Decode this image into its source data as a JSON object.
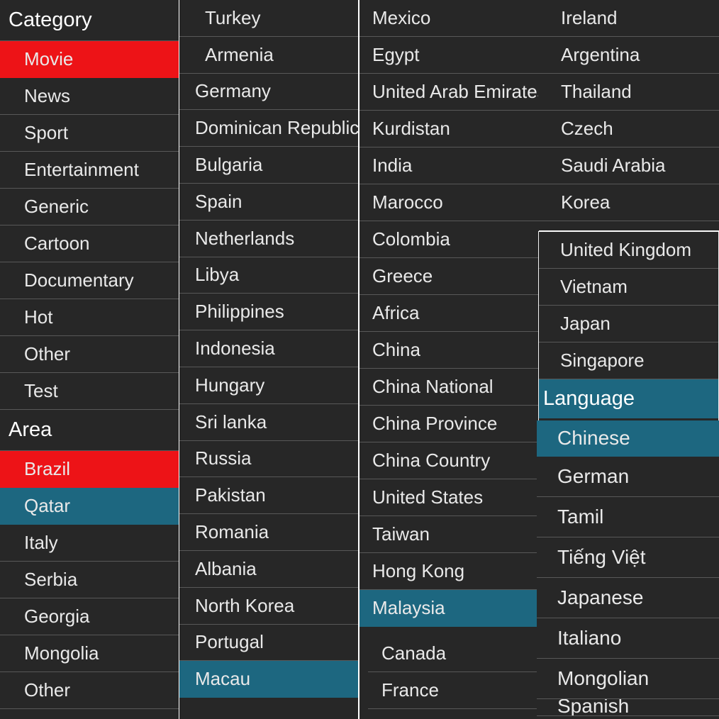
{
  "theme": {
    "background": "#272727",
    "selected_red": "#ed1317",
    "selected_teal": "#1d6780",
    "text": "#e9e9e9",
    "separator": "#585858"
  },
  "column_category_area": {
    "headers": {
      "category": "Category",
      "area": "Area"
    },
    "category_items": [
      {
        "label": "Movie",
        "state": "selected-red"
      },
      {
        "label": "News",
        "state": "normal"
      },
      {
        "label": "Sport",
        "state": "normal"
      },
      {
        "label": "Entertainment",
        "state": "normal"
      },
      {
        "label": "Generic",
        "state": "normal"
      },
      {
        "label": "Cartoon",
        "state": "normal"
      },
      {
        "label": "Documentary",
        "state": "normal"
      },
      {
        "label": "Hot",
        "state": "normal"
      },
      {
        "label": "Other",
        "state": "normal"
      },
      {
        "label": "Test",
        "state": "normal"
      }
    ],
    "area_items": [
      {
        "label": "Brazil",
        "state": "selected-red"
      },
      {
        "label": "Qatar",
        "state": "selected-teal"
      },
      {
        "label": "Italy",
        "state": "normal"
      },
      {
        "label": "Serbia",
        "state": "normal"
      },
      {
        "label": "Georgia",
        "state": "normal"
      },
      {
        "label": "Mongolia",
        "state": "normal"
      },
      {
        "label": "Other",
        "state": "normal"
      }
    ]
  },
  "column_two": {
    "items": [
      {
        "label": "Turkey",
        "state": "normal"
      },
      {
        "label": "Armenia",
        "state": "normal"
      },
      {
        "label": "Germany",
        "state": "normal"
      },
      {
        "label": "Dominican Republic",
        "state": "normal"
      },
      {
        "label": "Bulgaria",
        "state": "normal"
      },
      {
        "label": "Spain",
        "state": "normal"
      },
      {
        "label": "Netherlands",
        "state": "normal"
      },
      {
        "label": "Libya",
        "state": "normal"
      },
      {
        "label": "Philippines",
        "state": "normal"
      },
      {
        "label": "Indonesia",
        "state": "normal"
      },
      {
        "label": "Hungary",
        "state": "normal"
      },
      {
        "label": "Sri lanka",
        "state": "normal"
      },
      {
        "label": "Russia",
        "state": "normal"
      },
      {
        "label": "Pakistan",
        "state": "normal"
      },
      {
        "label": "Romania",
        "state": "normal"
      },
      {
        "label": "Albania",
        "state": "normal"
      },
      {
        "label": "North Korea",
        "state": "normal"
      },
      {
        "label": "Portugal",
        "state": "normal"
      },
      {
        "label": "Macau",
        "state": "selected-teal"
      }
    ]
  },
  "column_three": {
    "items": [
      {
        "label": "Mexico",
        "state": "normal"
      },
      {
        "label": "Egypt",
        "state": "normal"
      },
      {
        "label": "United Arab Emirates",
        "state": "normal"
      },
      {
        "label": "Kurdistan",
        "state": "normal"
      },
      {
        "label": "India",
        "state": "normal"
      },
      {
        "label": "Marocco",
        "state": "normal"
      },
      {
        "label": "Colombia",
        "state": "normal"
      },
      {
        "label": "Greece",
        "state": "normal"
      },
      {
        "label": "Africa",
        "state": "normal"
      },
      {
        "label": "China",
        "state": "normal"
      },
      {
        "label": "China National",
        "state": "normal"
      },
      {
        "label": "China Province",
        "state": "normal"
      },
      {
        "label": "China Country",
        "state": "normal"
      },
      {
        "label": "United States",
        "state": "normal"
      },
      {
        "label": "Taiwan",
        "state": "normal"
      },
      {
        "label": "Hong Kong",
        "state": "normal"
      },
      {
        "label": "Malaysia",
        "state": "selected-teal"
      }
    ],
    "subpanel_items": [
      {
        "label": "Canada",
        "state": "normal"
      },
      {
        "label": "France",
        "state": "normal"
      }
    ]
  },
  "column_four": {
    "items": [
      {
        "label": "Ireland",
        "state": "normal"
      },
      {
        "label": "Argentina",
        "state": "normal"
      },
      {
        "label": "Thailand",
        "state": "normal"
      },
      {
        "label": "Czech",
        "state": "normal"
      },
      {
        "label": "Saudi Arabia",
        "state": "normal"
      },
      {
        "label": "Korea",
        "state": "normal"
      }
    ]
  },
  "overlay_panel": {
    "items": [
      {
        "label": "United Kingdom",
        "state": "normal"
      },
      {
        "label": "Vietnam",
        "state": "normal"
      },
      {
        "label": "Japan",
        "state": "normal"
      },
      {
        "label": "Singapore",
        "state": "normal"
      }
    ],
    "language_header": "Language"
  },
  "language_panel": {
    "items": [
      {
        "label": "Chinese",
        "state": "selected-teal"
      },
      {
        "label": "German",
        "state": "normal"
      },
      {
        "label": "Tamil",
        "state": "normal"
      },
      {
        "label": "Tiếng Việt",
        "state": "normal"
      },
      {
        "label": "Japanese",
        "state": "normal"
      },
      {
        "label": "Italiano",
        "state": "normal"
      },
      {
        "label": "Mongolian",
        "state": "normal"
      },
      {
        "label": "Spanish",
        "state": "clipped"
      }
    ]
  }
}
